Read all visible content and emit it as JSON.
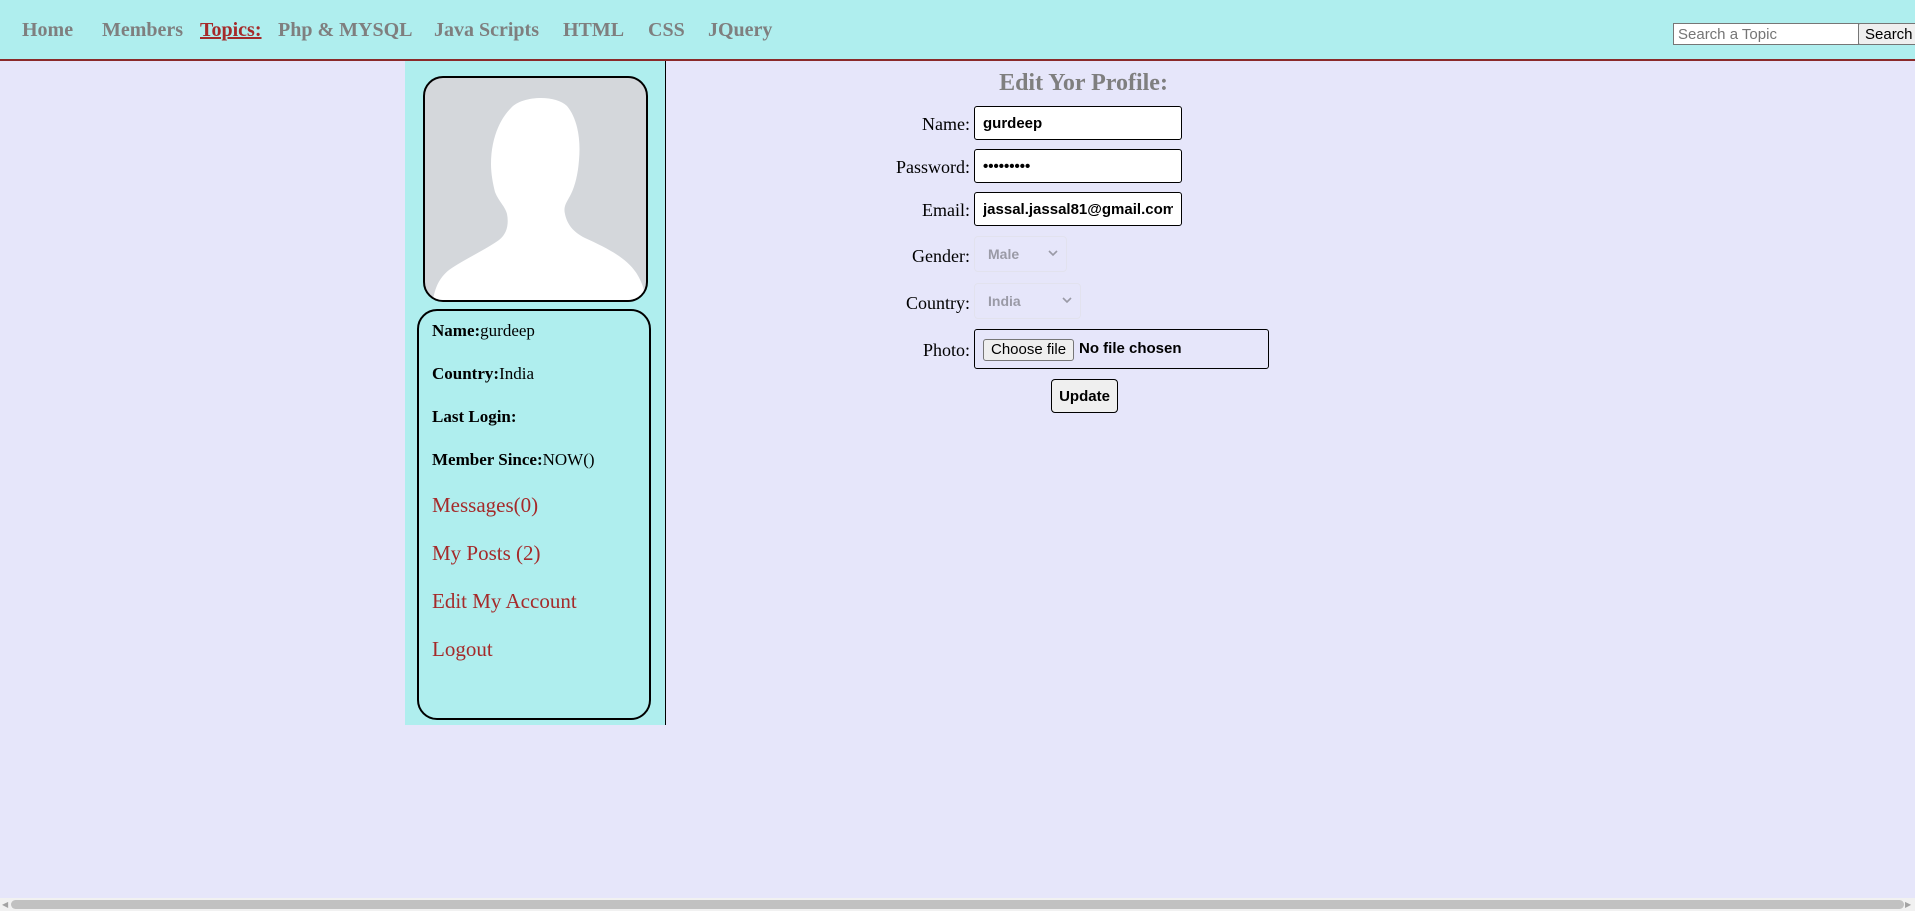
{
  "nav": {
    "home": "Home",
    "members": "Members",
    "topics": "Topics:",
    "php_mysql": "Php & MYSQL",
    "java_scripts": "Java Scripts",
    "html": "HTML",
    "css": "CSS",
    "jquery": "JQuery",
    "search_placeholder": "Search a Topic",
    "search_button": "Search"
  },
  "sidebar": {
    "avatar_icon": "default-user-silhouette",
    "name_label": "Name:",
    "name_value": "gurdeep",
    "country_label": "Country:",
    "country_value": "India",
    "last_login_label": "Last Login:",
    "last_login_value": "",
    "member_since_label": "Member Since:",
    "member_since_value": "NOW()",
    "links": {
      "messages": "Messages(0)",
      "my_posts": "My Posts (2)",
      "edit_account": "Edit My Account",
      "logout": "Logout"
    }
  },
  "form": {
    "title": "Edit Yor Profile:",
    "name_label": "Name:",
    "name_value": "gurdeep",
    "password_label": "Password:",
    "password_value": "•••••••••",
    "email_label": "Email:",
    "email_value": "jassal.jassal81@gmail.com",
    "gender_label": "Gender:",
    "gender_value": "Male",
    "country_label": "Country:",
    "country_value": "India",
    "photo_label": "Photo:",
    "choose_file": "Choose file",
    "file_status": "No file chosen",
    "update_button": "Update"
  },
  "colors": {
    "page_bg": "#e6e6fa",
    "nav_bg": "#afeeee",
    "sidebar_bg": "#afeeee",
    "nav_text": "#7f7f7f",
    "accent_link": "#a52a2a",
    "avatar_bg": "#d4d7db"
  }
}
